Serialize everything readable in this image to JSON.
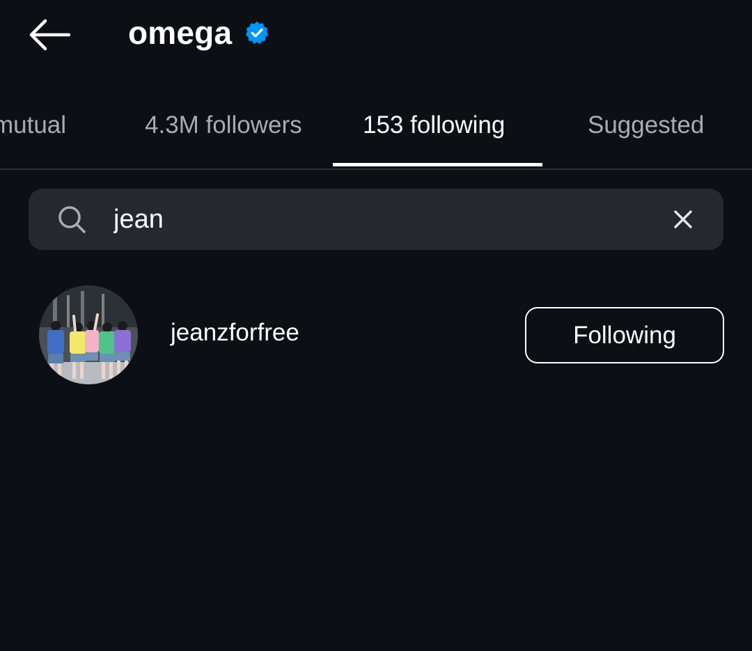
{
  "header": {
    "username": "omega",
    "verified_icon": "verified-badge-icon",
    "back_icon": "arrow-left-icon"
  },
  "tabs": [
    {
      "label": "mutual",
      "active": false
    },
    {
      "label": "4.3M followers",
      "active": false
    },
    {
      "label": "153 following",
      "active": true
    },
    {
      "label": "Suggested",
      "active": false
    }
  ],
  "search": {
    "value": "jean",
    "search_icon": "search-icon",
    "clear_icon": "close-icon"
  },
  "results": [
    {
      "username": "jeanzforfree",
      "button_label": "Following",
      "avatar": "avatar"
    }
  ],
  "colors": {
    "background": "#0c0f14",
    "search_bg": "#25292f",
    "verified": "#0095f6",
    "inactive_tab": "#a8acb3",
    "text": "#ffffff"
  }
}
